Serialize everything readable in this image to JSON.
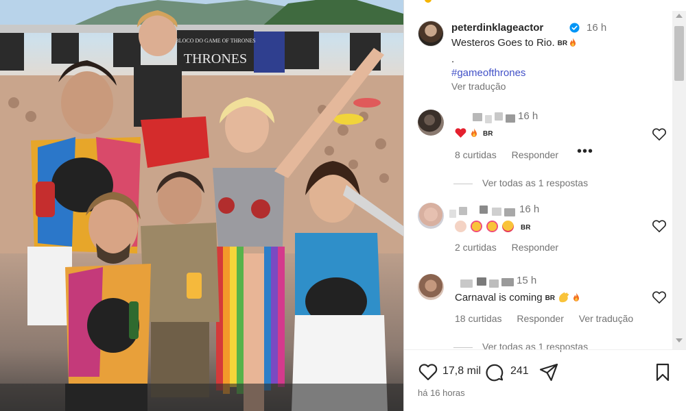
{
  "post": {
    "username": "peterdinklageactor",
    "verified": true,
    "time": "16 h",
    "caption": "Westeros Goes to Rio.",
    "caption_flag": "BR",
    "caption_dot": ".",
    "hashtag": "#gameofthrones",
    "translate": "Ver tradução",
    "likes": "17,8 mil",
    "comments_count": "241",
    "posted_ago": "há 16 horas",
    "photo_banner": "BLOCO DO GAME OF THRONES"
  },
  "comments": [
    {
      "time": "16 h",
      "flag": "BR",
      "likes_label": "8 curtidas",
      "reply_label": "Responder",
      "replies_label": "Ver todas as 1 respostas"
    },
    {
      "time": "16 h",
      "flag": "BR",
      "likes_label": "2 curtidas",
      "reply_label": "Responder"
    },
    {
      "time": "15 h",
      "text": "Carnaval is coming",
      "flag": "BR",
      "likes_label": "18 curtidas",
      "reply_label": "Responder",
      "translate_label": "Ver tradução",
      "replies_label": "Ver todas as 1 respostas"
    }
  ],
  "icons": {
    "like": "heart-icon",
    "comment": "comment-icon",
    "share": "share-icon",
    "save": "bookmark-icon",
    "more": "more-dots-icon",
    "verified": "verified-badge-icon"
  },
  "colors": {
    "hashtag": "#4150c7",
    "secondary_text": "#737373",
    "verified": "#0095f6"
  }
}
